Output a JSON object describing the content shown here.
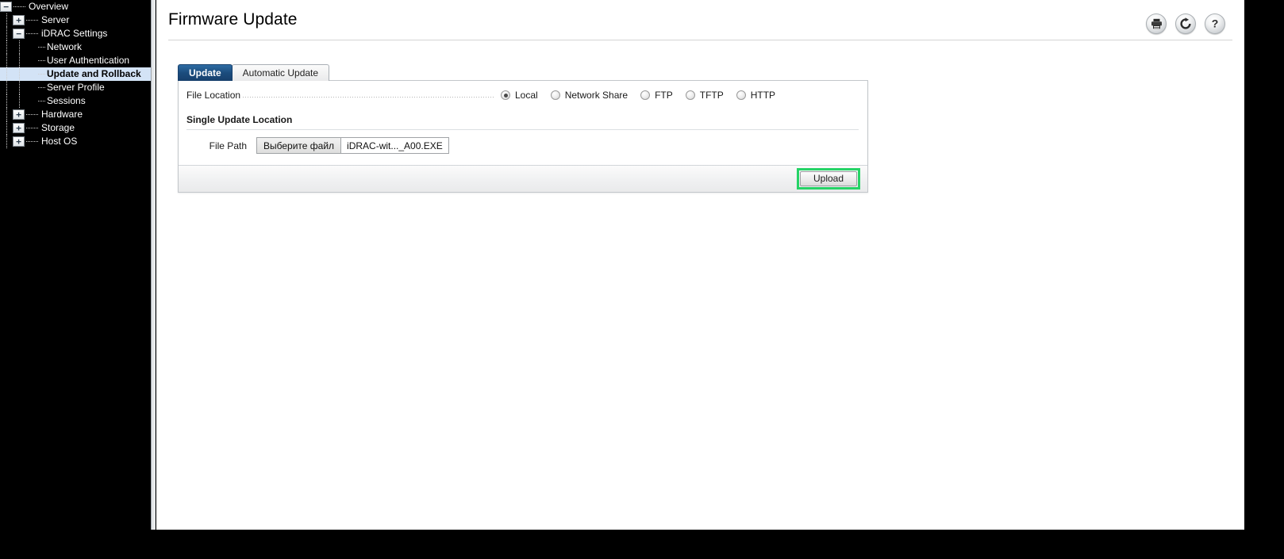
{
  "header": {
    "title": "Firmware Update",
    "icons": [
      {
        "name": "print-icon",
        "title": "Print"
      },
      {
        "name": "refresh-icon",
        "title": "Refresh"
      },
      {
        "name": "help-icon",
        "title": "Help"
      }
    ]
  },
  "sidebar": {
    "items": [
      {
        "label": "Overview",
        "depth": 0,
        "toggle": "minus",
        "selected": false
      },
      {
        "label": "Server",
        "depth": 1,
        "toggle": "plus",
        "selected": false
      },
      {
        "label": "iDRAC Settings",
        "depth": 1,
        "toggle": "minus",
        "selected": false
      },
      {
        "label": "Network",
        "depth": 2,
        "toggle": "none",
        "selected": false
      },
      {
        "label": "User Authentication",
        "depth": 2,
        "toggle": "none",
        "selected": false
      },
      {
        "label": "Update and Rollback",
        "depth": 2,
        "toggle": "none",
        "selected": true
      },
      {
        "label": "Server Profile",
        "depth": 2,
        "toggle": "none",
        "selected": false
      },
      {
        "label": "Sessions",
        "depth": 2,
        "toggle": "none",
        "selected": false
      },
      {
        "label": "Hardware",
        "depth": 1,
        "toggle": "plus",
        "selected": false
      },
      {
        "label": "Storage",
        "depth": 1,
        "toggle": "plus",
        "selected": false
      },
      {
        "label": "Host OS",
        "depth": 1,
        "toggle": "plus",
        "selected": false
      }
    ]
  },
  "tabs": [
    {
      "label": "Update",
      "active": true
    },
    {
      "label": "Automatic Update",
      "active": false
    }
  ],
  "form": {
    "file_location_label": "File Location",
    "file_location_options": [
      {
        "label": "Local",
        "checked": true
      },
      {
        "label": "Network Share",
        "checked": false
      },
      {
        "label": "FTP",
        "checked": false
      },
      {
        "label": "TFTP",
        "checked": false
      },
      {
        "label": "HTTP",
        "checked": false
      }
    ],
    "section_title": "Single Update Location",
    "file_path_label": "File Path",
    "file_choose_button": "Выберите файл",
    "file_selected_name": "iDRAC-wit..._A00.EXE",
    "upload_button": "Upload"
  },
  "colors": {
    "tab_active": "#1b4c7d",
    "tree_selection": "#d3e3f6",
    "highlight_green": "#25d366",
    "sidebar_bg": "#000000"
  }
}
